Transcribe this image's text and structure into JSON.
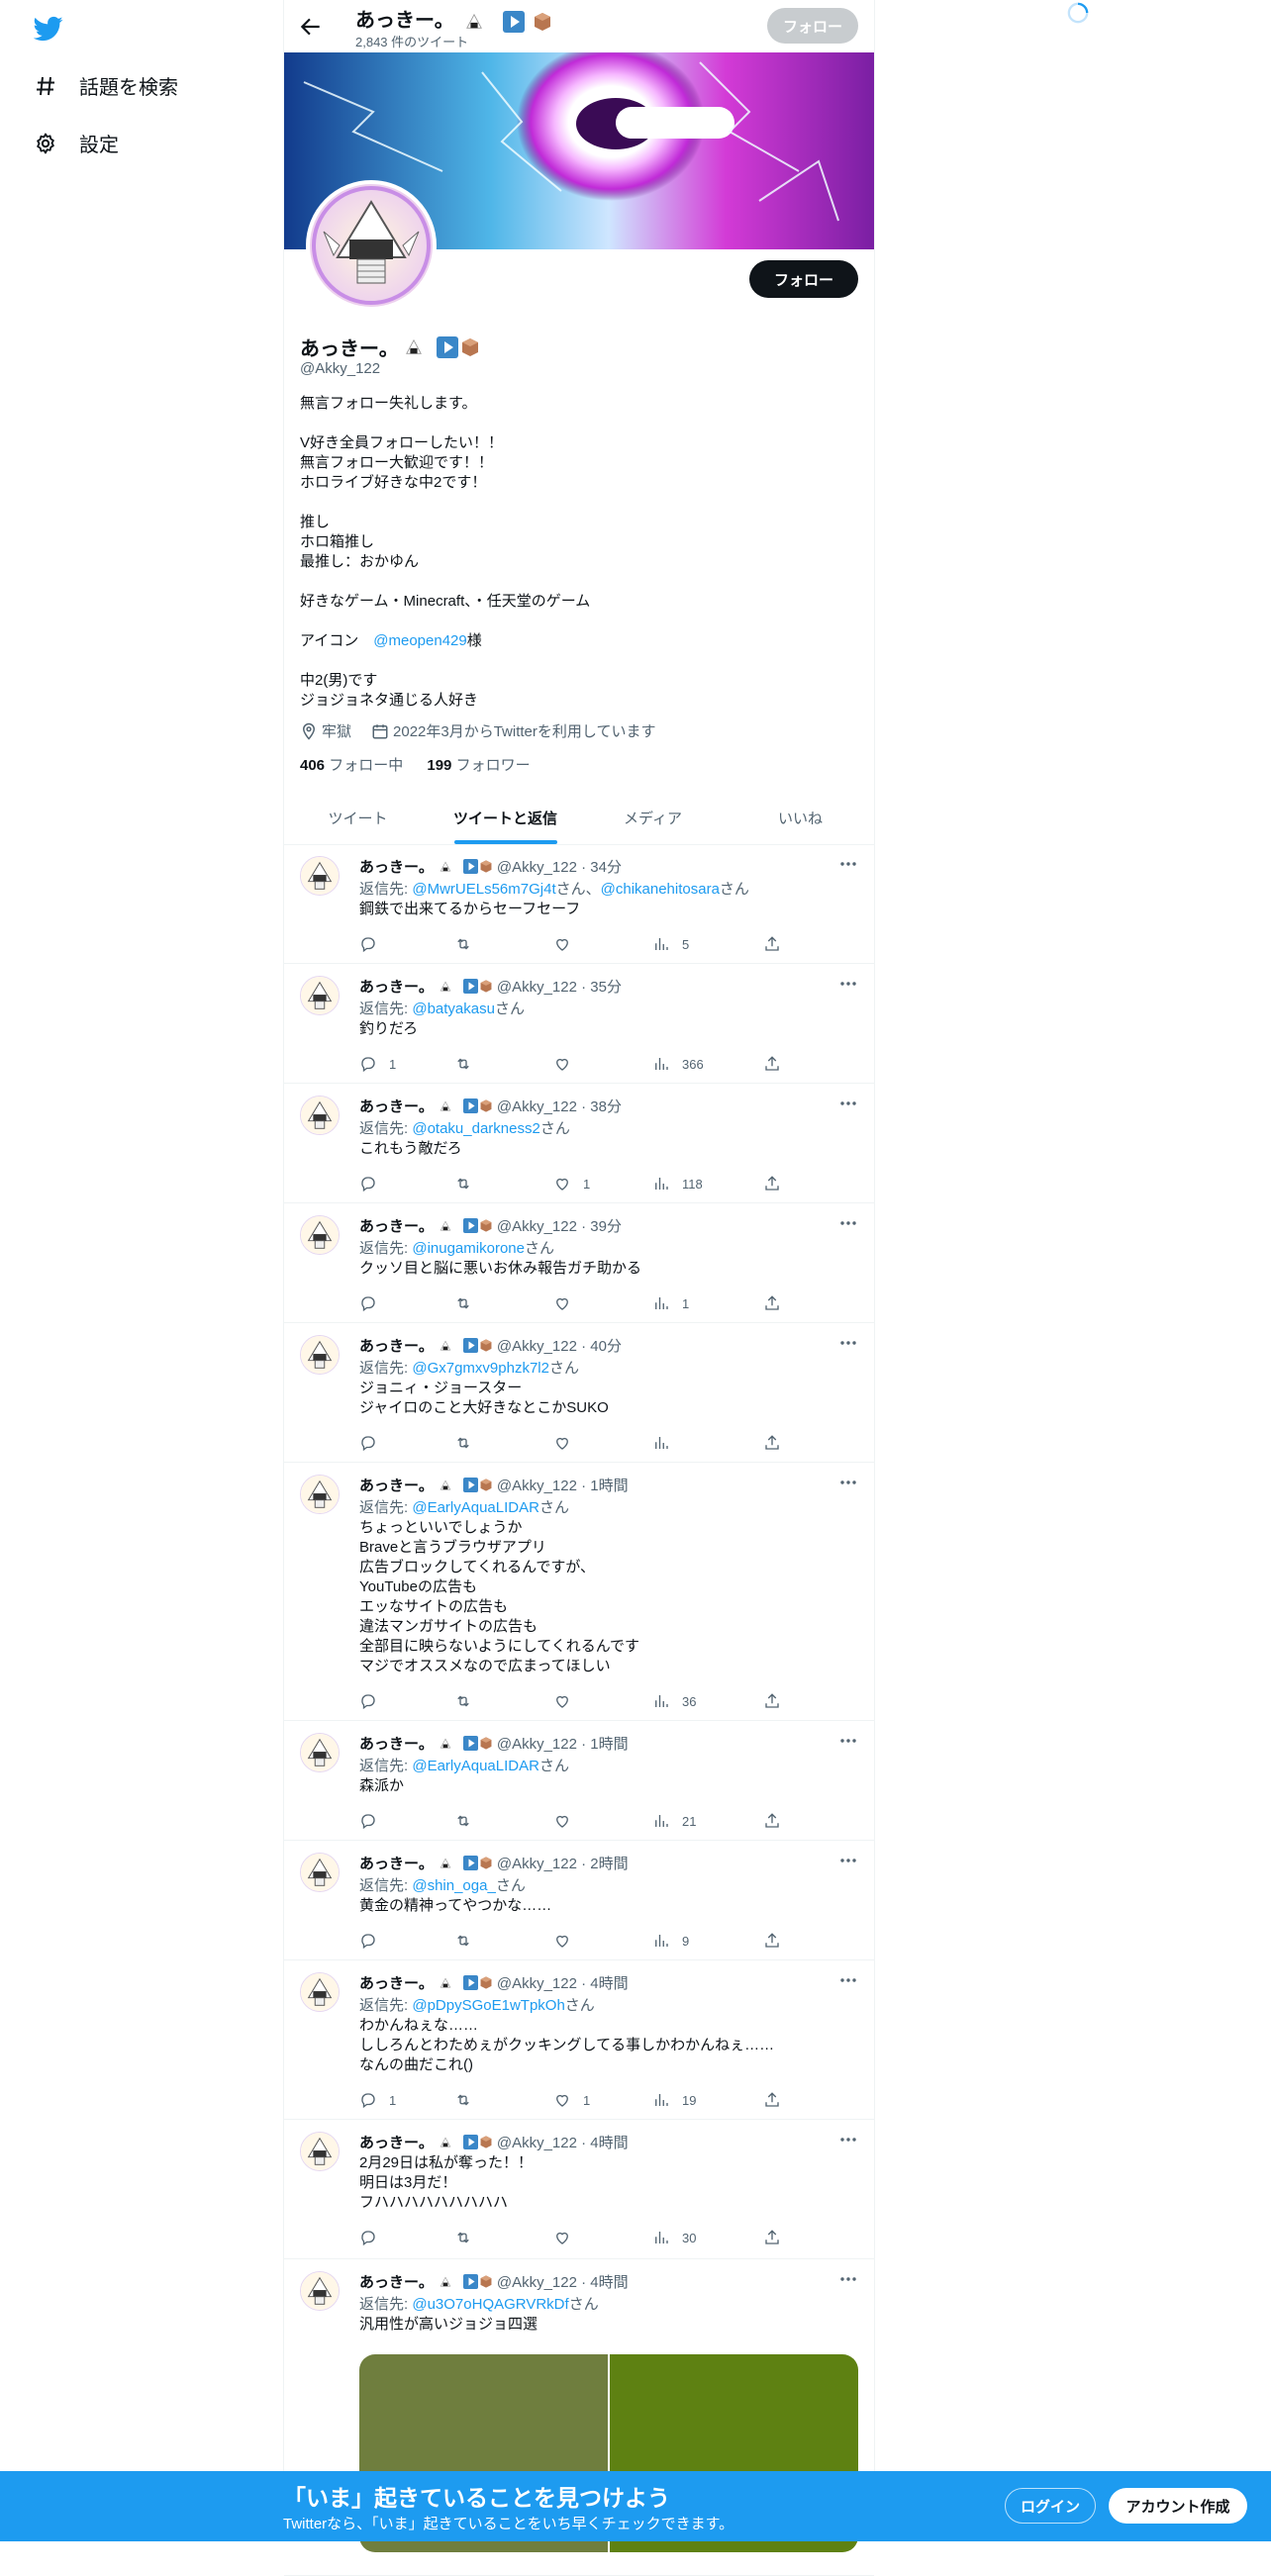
{
  "sidebar": {
    "items": [
      {
        "label": "話題を検索",
        "icon": "hashtag-icon"
      },
      {
        "label": "設定",
        "icon": "gear-icon"
      }
    ]
  },
  "header": {
    "name": "あっきー。",
    "tweet_count": "2,843 件のツイート",
    "follow_label": "フォロー"
  },
  "profile": {
    "name": "あっきー。",
    "handle": "@Akky_122",
    "follow_label": "フォロー",
    "bio": [
      "無言フォロー失礼します。",
      "",
      "V好き全員フォローしたい！！",
      "無言フォロー大歓迎です！！",
      "ホロライブ好きな中2です！",
      "",
      "推し",
      "ホロ箱推し",
      "最推し：おかゆん",
      "",
      "好きなゲーム・Minecraft、・任天堂のゲーム",
      ""
    ],
    "icon_line_prefix": "アイコン　",
    "icon_line_link": "@meopen429",
    "icon_line_suffix": "様",
    "bio2": [
      "",
      "中2(男)です",
      "ジョジョネタ通じる人好き"
    ],
    "location": "牢獄",
    "joined": "2022年3月からTwitterを利用しています",
    "following_count": "406",
    "following_label": " フォロー中",
    "followers_count": "199",
    "followers_label": " フォロワー"
  },
  "tabs": [
    "ツイート",
    "ツイートと返信",
    "メディア",
    "いいね"
  ],
  "tweets": [
    {
      "name": "あっきー。",
      "meta": "@Akky_122 · 34分",
      "reply_prefix": "返信先: ",
      "reply_link": "@MwrUELs56m7Gj4t",
      "reply_rest": "さん、",
      "reply_link2": "@chikanehitosara",
      "reply_rest2": "さん",
      "lines": [
        "鋼鉄で出来てるからセーフセーフ"
      ],
      "replies": "",
      "retweets": "",
      "likes": "",
      "views": "5"
    },
    {
      "name": "あっきー。",
      "meta": "@Akky_122 · 35分",
      "reply_prefix": "返信先: ",
      "reply_link": "@batyakasu",
      "reply_rest": "さん",
      "lines": [
        "釣りだろ"
      ],
      "replies": "1",
      "retweets": "",
      "likes": "",
      "views": "366"
    },
    {
      "name": "あっきー。",
      "meta": "@Akky_122 · 38分",
      "reply_prefix": "返信先: ",
      "reply_link": "@otaku_darkness2",
      "reply_rest": "さん",
      "lines": [
        "これもう敵だろ"
      ],
      "replies": "",
      "retweets": "",
      "likes": "1",
      "views": "118"
    },
    {
      "name": "あっきー。",
      "meta": "@Akky_122 · 39分",
      "reply_prefix": "返信先: ",
      "reply_link": "@inugamikorone",
      "reply_rest": "さん",
      "lines": [
        "クッソ目と脳に悪いお休み報告ガチ助かる"
      ],
      "replies": "",
      "retweets": "",
      "likes": "",
      "views": "1"
    },
    {
      "name": "あっきー。",
      "meta": "@Akky_122 · 40分",
      "reply_prefix": "返信先: ",
      "reply_link": "@Gx7gmxv9phzk7l2",
      "reply_rest": "さん",
      "lines": [
        "ジョニィ・ジョースター",
        "ジャイロのこと大好きなとこかSUKO"
      ],
      "replies": "",
      "retweets": "",
      "likes": "",
      "views": ""
    },
    {
      "name": "あっきー。",
      "meta": "@Akky_122 · 1時間",
      "reply_prefix": "返信先: ",
      "reply_link": "@EarlyAquaLIDAR",
      "reply_rest": "さん",
      "lines": [
        "ちょっといいでしょうか",
        "Braveと言うブラウザアプリ",
        "広告ブロックしてくれるんですが、",
        "YouTubeの広告も",
        "エッなサイトの広告も",
        "違法マンガサイトの広告も",
        "全部目に映らないようにしてくれるんです",
        "マジでオススメなので広まってほしい"
      ],
      "replies": "",
      "retweets": "",
      "likes": "",
      "views": "36"
    },
    {
      "name": "あっきー。",
      "meta": "@Akky_122 · 1時間",
      "reply_prefix": "返信先: ",
      "reply_link": "@EarlyAquaLIDAR",
      "reply_rest": "さん",
      "lines": [
        "森派か"
      ],
      "replies": "",
      "retweets": "",
      "likes": "",
      "views": "21"
    },
    {
      "name": "あっきー。",
      "meta": "@Akky_122 · 2時間",
      "reply_prefix": "返信先: ",
      "reply_link": "@shin_oga_",
      "reply_rest": "さん",
      "lines": [
        "黄金の精神ってやつかな……"
      ],
      "replies": "",
      "retweets": "",
      "likes": "",
      "views": "9"
    },
    {
      "name": "あっきー。",
      "meta": "@Akky_122 · 4時間",
      "reply_prefix": "返信先: ",
      "reply_link": "@pDpySGoE1wTpkOh",
      "reply_rest": "さん",
      "lines": [
        "わかんねぇな……",
        "ししろんとわためぇがクッキングしてる事しかわかんねぇ……",
        "なんの曲だこれ()"
      ],
      "replies": "1",
      "retweets": "",
      "likes": "1",
      "views": "19"
    },
    {
      "name": "あっきー。",
      "meta": "@Akky_122 · 4時間",
      "reply_prefix": "",
      "reply_link": "",
      "reply_rest": "",
      "lines": [
        "2月29日は私が奪った！！",
        "明日は3月だ！",
        "フハハハハハハハハハ"
      ],
      "replies": "",
      "retweets": "",
      "likes": "",
      "views": "30"
    },
    {
      "name": "あっきー。",
      "meta": "@Akky_122 · 4時間",
      "reply_prefix": "返信先: ",
      "reply_link": "@u3O7oHQAGRVRkDf",
      "reply_rest": "さん",
      "lines": [
        "汎用性が高いジョジョ四選"
      ],
      "replies": "",
      "retweets": "",
      "likes": "",
      "views": ""
    }
  ],
  "bottom_bar": {
    "title": "「いま」起きていることを見つけよう",
    "subtitle": "Twitterなら、「いま」起きていることをいち早くチェックできます。",
    "login_label": "ログイン",
    "signup_label": "アカウント作成"
  },
  "colors": {
    "accent": "#1d9bf0",
    "text": "#0f1419",
    "muted": "#536471"
  }
}
